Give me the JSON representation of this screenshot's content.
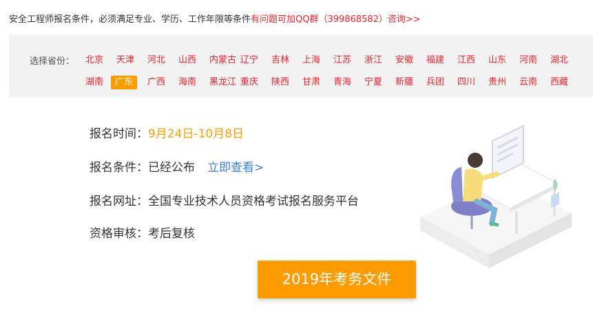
{
  "notice": {
    "text": "安全工程师报名条件，必须满足专业、学历、工作年限等条件",
    "highlight": "有问题可加QQ群（399868582）咨询>>"
  },
  "province_selector": {
    "label": "选择省份：",
    "row1": [
      "北京",
      "天津",
      "河北",
      "山西",
      "内蒙古",
      "辽宁",
      "吉林",
      "上海",
      "江苏",
      "浙江",
      "安徽",
      "福建",
      "江西",
      "山东",
      "河南",
      "湖北"
    ],
    "row2": [
      "湖南",
      "广东",
      "广西",
      "海南",
      "黑龙江",
      "重庆",
      "陕西",
      "甘肃",
      "青海",
      "宁夏",
      "新疆",
      "兵团",
      "四川",
      "贵州",
      "云南",
      "西藏"
    ],
    "active": "广东"
  },
  "info": {
    "time_label": "报名时间：",
    "time_value": "9月24日-10月8日",
    "cond_label": "报名条件：",
    "cond_value": "已经公布",
    "cond_link": "立即查看>",
    "site_label": "报名网址：",
    "site_value": "全国专业技术人员资格考试报名服务平台",
    "review_label": "资格审核：",
    "review_value": "考后复核"
  },
  "button": {
    "label": "2019年考务文件"
  },
  "colors": {
    "accent_red": "#e8222c",
    "accent_orange": "#fd9c02",
    "link_blue": "#3c7fd3"
  }
}
